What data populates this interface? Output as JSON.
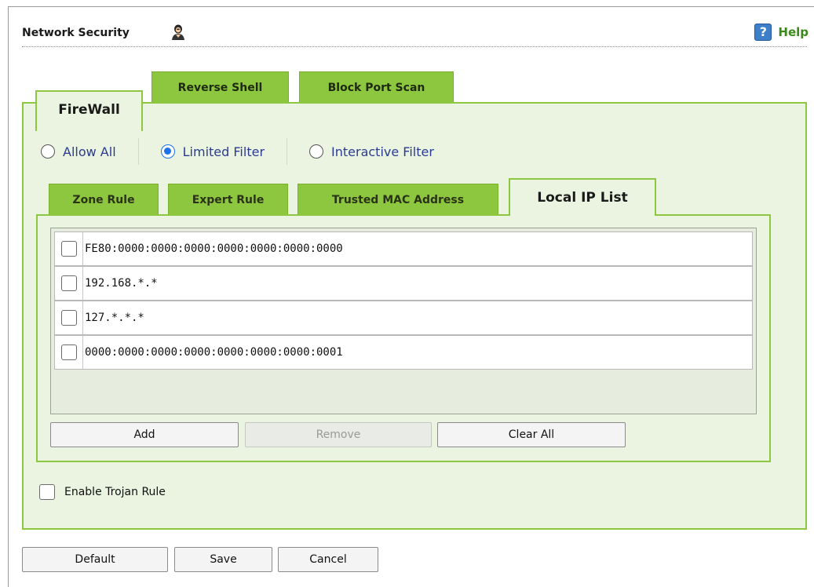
{
  "header": {
    "title": "Network Security",
    "help_label": "Help",
    "help_icon": "question-mark-icon",
    "title_icon": "user-icon"
  },
  "main_tabs": [
    {
      "label": "FireWall",
      "active": true
    },
    {
      "label": "Reverse Shell",
      "active": false
    },
    {
      "label": "Block Port Scan",
      "active": false
    }
  ],
  "filter_modes": [
    {
      "label": "Allow All",
      "checked": false
    },
    {
      "label": "Limited Filter",
      "checked": true
    },
    {
      "label": "Interactive Filter",
      "checked": false
    }
  ],
  "rule_tabs": [
    {
      "label": "Zone Rule",
      "active": false
    },
    {
      "label": "Expert Rule",
      "active": false
    },
    {
      "label": "Trusted MAC Address",
      "active": false
    },
    {
      "label": "Local IP List",
      "active": true
    }
  ],
  "ip_list": [
    {
      "ip": "FE80:0000:0000:0000:0000:0000:0000:0000",
      "checked": false
    },
    {
      "ip": "192.168.*.*",
      "checked": false
    },
    {
      "ip": "127.*.*.*",
      "checked": false
    },
    {
      "ip": "0000:0000:0000:0000:0000:0000:0000:0001",
      "checked": false
    }
  ],
  "list_buttons": {
    "add": "Add",
    "remove": "Remove",
    "clear_all": "Clear All"
  },
  "trojan": {
    "label": "Enable Trojan Rule",
    "checked": false
  },
  "footer_buttons": {
    "default": "Default",
    "save": "Save",
    "cancel": "Cancel"
  },
  "colors": {
    "accent_green": "#8dc63f",
    "panel_bg": "#eaf4e1",
    "radio_blue": "#1a73e8",
    "help_green": "#3a8a1a"
  }
}
